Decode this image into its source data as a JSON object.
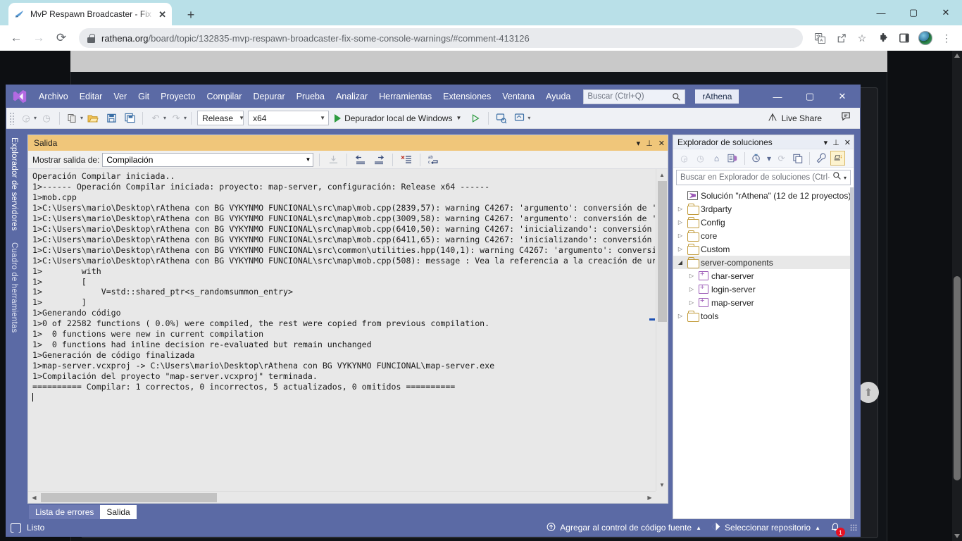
{
  "browser": {
    "tab": {
      "title": "MvP Respawn Broadcaster - Fix s",
      "close": "✕",
      "favicon": "rathena-favicon"
    },
    "new_tab": "+",
    "window_controls": {
      "minimize": "—",
      "maximize": "▢",
      "close": "✕"
    },
    "nav": {
      "back": "←",
      "forward": "→",
      "reload": "⟳"
    },
    "url_domain": "rathena.org",
    "url_path": "/board/topic/132835-mvp-respawn-broadcaster-fix-some-console-warnings/#comment-413126",
    "toolbar_icons": [
      "translate-icon",
      "share-icon",
      "bookmark-star-icon",
      "extensions-puzzle-icon",
      "sidepanel-icon",
      "profile-avatar-icon",
      "chrome-menu-icon"
    ]
  },
  "vs": {
    "logo": "visual-studio-logo",
    "menu": [
      "Archivo",
      "Editar",
      "Ver",
      "Git",
      "Proyecto",
      "Compilar",
      "Depurar",
      "Prueba",
      "Analizar",
      "Herramientas",
      "Extensiones",
      "Ventana",
      "Ayuda"
    ],
    "search_placeholder": "Buscar (Ctrl+Q)",
    "account": "rAthena",
    "window_controls": {
      "minimize": "—",
      "maximize": "▢",
      "close": "✕"
    },
    "toolbar": {
      "config": "Release",
      "platform": "x64",
      "run_label": "Depurador local de Windows",
      "live_share": "Live Share"
    },
    "left_tabs": [
      "Explorador de servidores",
      "Cuadro de herramientas"
    ],
    "output": {
      "title": "Salida",
      "show_label": "Mostrar salida de:",
      "source": "Compilación",
      "tabs": [
        {
          "label": "Lista de errores",
          "active": false
        },
        {
          "label": "Salida",
          "active": true
        }
      ],
      "lines": [
        "Operación Compilar iniciada..",
        "1>------ Operación Compilar iniciada: proyecto: map-server, configuración: Release x64 ------",
        "1>mob.cpp",
        "1>C:\\Users\\mario\\Desktop\\rAthena con BG VYKYNMO FUNCIONAL\\src\\map\\mob.cpp(2839,57): warning C4267: 'argumento': conversión de '",
        "1>C:\\Users\\mario\\Desktop\\rAthena con BG VYKYNMO FUNCIONAL\\src\\map\\mob.cpp(3009,58): warning C4267: 'argumento': conversión de '",
        "1>C:\\Users\\mario\\Desktop\\rAthena con BG VYKYNMO FUNCIONAL\\src\\map\\mob.cpp(6410,50): warning C4267: 'inicializando': conversión",
        "1>C:\\Users\\mario\\Desktop\\rAthena con BG VYKYNMO FUNCIONAL\\src\\map\\mob.cpp(6411,65): warning C4267: 'inicializando': conversión",
        "1>C:\\Users\\mario\\Desktop\\rAthena con BG VYKYNMO FUNCIONAL\\src\\common\\utilities.hpp(140,1): warning C4267: 'argumento': conversi",
        "1>C:\\Users\\mario\\Desktop\\rAthena con BG VYKYNMO FUNCIONAL\\src\\map\\mob.cpp(508): message : Vea la referencia a la creación de ur",
        "1>        with",
        "1>        [",
        "1>            V=std::shared_ptr<s_randomsummon_entry>",
        "1>        ]",
        "1>Generando código",
        "1>0 of 22582 functions ( 0.0%) were compiled, the rest were copied from previous compilation.",
        "1>  0 functions were new in current compilation",
        "1>  0 functions had inline decision re-evaluated but remain unchanged",
        "1>Generación de código finalizada",
        "1>map-server.vcxproj -> C:\\Users\\mario\\Desktop\\rAthena con BG VYKYNMO FUNCIONAL\\map-server.exe",
        "1>Compilación del proyecto \"map-server.vcxproj\" terminada.",
        "========== Compilar: 1 correctos, 0 incorrectos, 5 actualizados, 0 omitidos =========="
      ]
    },
    "solution_explorer": {
      "title": "Explorador de soluciones",
      "search_placeholder": "Buscar en Explorador de soluciones (Ctrl·",
      "root": "Solución \"rAthena\" (12 de 12 proyectos)",
      "nodes": [
        {
          "label": "3rdparty",
          "type": "folder",
          "expanded": false,
          "level": 0,
          "selected": false
        },
        {
          "label": "Config",
          "type": "folder",
          "expanded": false,
          "level": 0,
          "selected": false
        },
        {
          "label": "core",
          "type": "folder",
          "expanded": false,
          "level": 0,
          "selected": false
        },
        {
          "label": "Custom",
          "type": "folder",
          "expanded": false,
          "level": 0,
          "selected": false
        },
        {
          "label": "server-components",
          "type": "folder",
          "expanded": true,
          "level": 0,
          "selected": true
        },
        {
          "label": "char-server",
          "type": "project",
          "expanded": false,
          "level": 1,
          "selected": false
        },
        {
          "label": "login-server",
          "type": "project",
          "expanded": false,
          "level": 1,
          "selected": false
        },
        {
          "label": "map-server",
          "type": "project",
          "expanded": false,
          "level": 1,
          "selected": false
        },
        {
          "label": "tools",
          "type": "folder",
          "expanded": false,
          "level": 0,
          "selected": false
        }
      ]
    },
    "status": {
      "ready": "Listo",
      "source_control": "Agregar al control de código fuente",
      "repository": "Seleccionar repositorio",
      "notification_count": "1"
    }
  },
  "colors": {
    "vs_chrome": "#5b6aa5",
    "output_header": "#f0c67a",
    "browser_tabstrip": "#b9e0e8",
    "accent_green": "#2d9b3f",
    "badge_red": "#e81123"
  }
}
